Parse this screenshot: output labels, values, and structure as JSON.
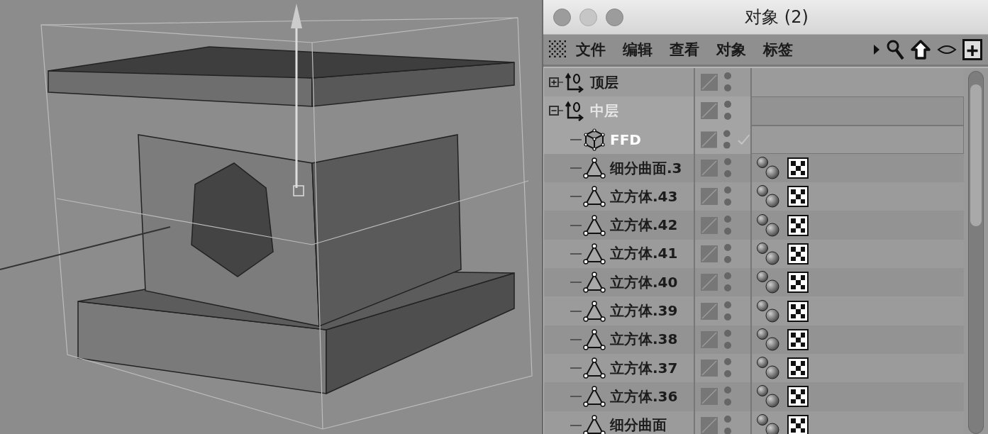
{
  "window": {
    "title": "对象 (2)"
  },
  "menu": [
    "文件",
    "编辑",
    "查看",
    "对象",
    "标签"
  ],
  "tree": [
    {
      "name": "顶层",
      "kind": "null",
      "expanded": false,
      "selected": false,
      "checked": false,
      "tags": false
    },
    {
      "name": "中层",
      "kind": "null",
      "expanded": true,
      "selected": true,
      "checked": false,
      "tags": false,
      "children": [
        {
          "name": "FFD",
          "kind": "ffd",
          "selected": true,
          "checked": true,
          "tags": false
        },
        {
          "name": "细分曲面.3",
          "kind": "polygon",
          "selected": false,
          "checked": false,
          "tags": true
        },
        {
          "name": "立方体.43",
          "kind": "polygon",
          "selected": false,
          "checked": false,
          "tags": true
        },
        {
          "name": "立方体.42",
          "kind": "polygon",
          "selected": false,
          "checked": false,
          "tags": true
        },
        {
          "name": "立方体.41",
          "kind": "polygon",
          "selected": false,
          "checked": false,
          "tags": true
        },
        {
          "name": "立方体.40",
          "kind": "polygon",
          "selected": false,
          "checked": false,
          "tags": true
        },
        {
          "name": "立方体.39",
          "kind": "polygon",
          "selected": false,
          "checked": false,
          "tags": true
        },
        {
          "name": "立方体.38",
          "kind": "polygon",
          "selected": false,
          "checked": false,
          "tags": true
        },
        {
          "name": "立方体.37",
          "kind": "polygon",
          "selected": false,
          "checked": false,
          "tags": true
        },
        {
          "name": "立方体.36",
          "kind": "polygon",
          "selected": false,
          "checked": false,
          "tags": true
        },
        {
          "name": "细分曲面",
          "kind": "polygon",
          "selected": false,
          "checked": false,
          "tags": true
        }
      ]
    }
  ]
}
